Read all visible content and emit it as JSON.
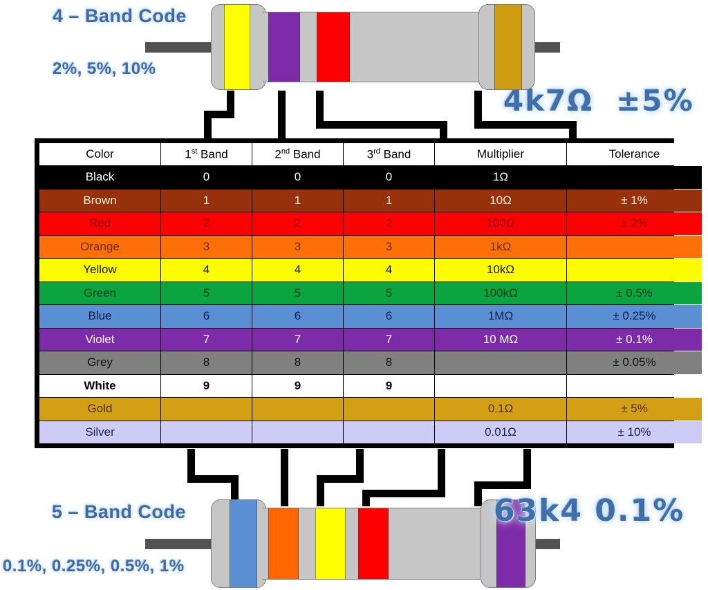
{
  "top_section": {
    "title": "4 – Band Code",
    "tolerances": "2%, 5%, 10%",
    "value": "4k7Ω",
    "value_tolerance": "±5%",
    "resistor_bands": [
      {
        "name": "Yellow",
        "color": "#ffff00"
      },
      {
        "name": "Violet",
        "color": "#7d2ba8"
      },
      {
        "name": "Red",
        "color": "#ff0000"
      },
      {
        "name": "Gold",
        "color": "#ce9c10"
      }
    ]
  },
  "bottom_section": {
    "title": "5 – Band Code",
    "tolerances": "0.1%, 0.25%, 0.5%, 1%",
    "value": "63k4 0.1%",
    "resistor_bands": [
      {
        "name": "Blue",
        "color": "#5b8fd4"
      },
      {
        "name": "Orange",
        "color": "#ff6600"
      },
      {
        "name": "Yellow",
        "color": "#ffff00"
      },
      {
        "name": "Red",
        "color": "#ff0000"
      },
      {
        "name": "Violet",
        "color": "#7d2ba8"
      }
    ]
  },
  "table": {
    "headers": {
      "color": "Color",
      "band1_prefix": "1",
      "band1_sup": "st",
      "band1_suffix": " Band",
      "band2_prefix": "2",
      "band2_sup": "nd",
      "band2_suffix": " Band",
      "band3_prefix": "3",
      "band3_sup": "rd",
      "band3_suffix": " Band",
      "multiplier": "Multiplier",
      "tolerance": "Tolerance"
    },
    "rows": [
      {
        "color": "Black",
        "b1": "0",
        "b2": "0",
        "b3": "0",
        "mult": "1Ω",
        "tol": "",
        "bg": "#000000",
        "fg": "#ffffff",
        "bold": false
      },
      {
        "color": "Brown",
        "b1": "1",
        "b2": "1",
        "b3": "1",
        "mult": "10Ω",
        "tol": "± 1%",
        "bg": "#97310c",
        "fg": "#fdf0de",
        "bold": false
      },
      {
        "color": "Red",
        "b1": "2",
        "b2": "2",
        "b3": "2",
        "mult": "100Ω",
        "tol": "± 2%",
        "bg": "#fe0000",
        "fg": "#8a0d0d",
        "bold": false
      },
      {
        "color": "Orange",
        "b1": "3",
        "b2": "3",
        "b3": "3",
        "mult": "1kΩ",
        "tol": "",
        "bg": "#fc7007",
        "fg": "#6b2c05",
        "bold": false
      },
      {
        "color": "Yellow",
        "b1": "4",
        "b2": "4",
        "b3": "4",
        "mult": "10kΩ",
        "tol": "",
        "bg": "#fdfd00",
        "fg": "#141414",
        "bold": false
      },
      {
        "color": "Green",
        "b1": "5",
        "b2": "5",
        "b3": "5",
        "mult": "100kΩ",
        "tol": "± 0.5%",
        "bg": "#0aa541",
        "fg": "#0a3d18",
        "bold": false
      },
      {
        "color": "Blue",
        "b1": "6",
        "b2": "6",
        "b3": "6",
        "mult": "1MΩ",
        "tol": "± 0.25%",
        "bg": "#5b8fd4",
        "fg": "#0d1c4a",
        "bold": false
      },
      {
        "color": "Violet",
        "b1": "7",
        "b2": "7",
        "b3": "7",
        "mult": "10 MΩ",
        "tol": "± 0.1%",
        "bg": "#7d2ba8",
        "fg": "#ffffff",
        "bold": false
      },
      {
        "color": "Grey",
        "b1": "8",
        "b2": "8",
        "b3": "8",
        "mult": "",
        "tol": "± 0.05%",
        "bg": "#808080",
        "fg": "#111111",
        "bold": false
      },
      {
        "color": "White",
        "b1": "9",
        "b2": "9",
        "b3": "9",
        "mult": "",
        "tol": "",
        "bg": "#ffffff",
        "fg": "#000000",
        "bold": true
      },
      {
        "color": "Gold",
        "b1": "",
        "b2": "",
        "b3": "",
        "mult": "0.1Ω",
        "tol": "± 5%",
        "bg": "#d3a013",
        "fg": "#4d2f04",
        "bold": false
      },
      {
        "color": "Silver",
        "b1": "",
        "b2": "",
        "b3": "",
        "mult": "0.01Ω",
        "tol": "± 10%",
        "bg": "#ccccf7",
        "fg": "#16234f",
        "bold": false
      }
    ]
  }
}
